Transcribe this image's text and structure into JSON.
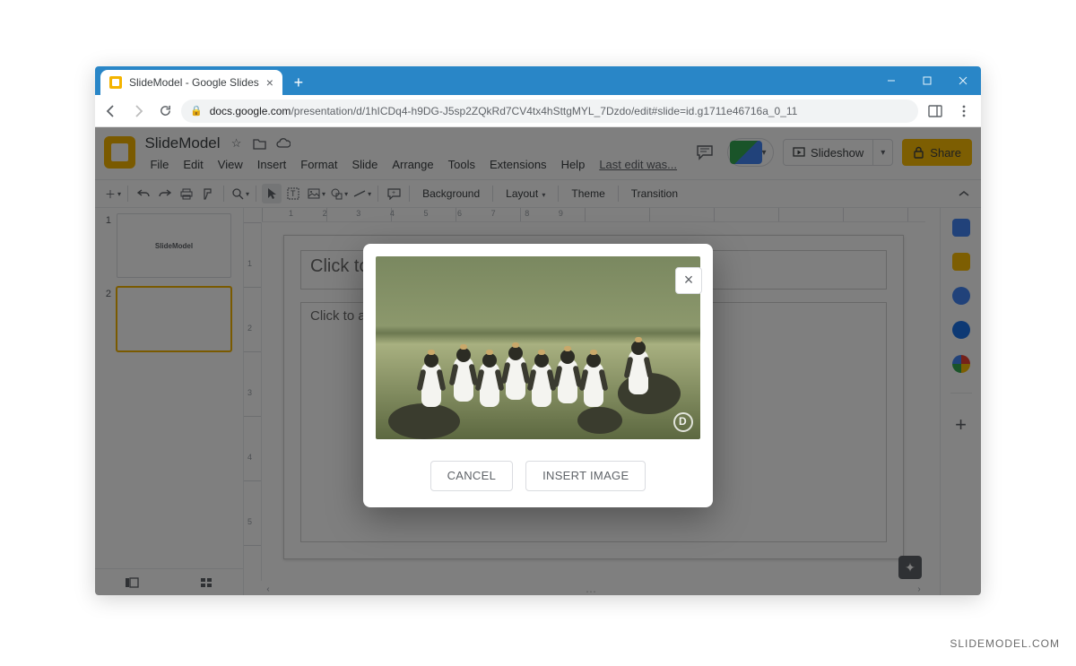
{
  "browser": {
    "tab_title": "SlideModel - Google Slides",
    "url_host": "docs.google.com",
    "url_path": "/presentation/d/1hICDq4-h9DG-J5sp2ZQkRd7CV4tx4hSttgMYL_7Dzdo/edit#slide=id.g1711e46716a_0_11"
  },
  "header": {
    "doc_title": "SlideModel",
    "last_edit": "Last edit was...",
    "slideshow": "Slideshow",
    "share": "Share"
  },
  "menu": {
    "file": "File",
    "edit": "Edit",
    "view": "View",
    "insert": "Insert",
    "format": "Format",
    "slide": "Slide",
    "arrange": "Arrange",
    "tools": "Tools",
    "extensions": "Extensions",
    "help": "Help"
  },
  "toolbar": {
    "background": "Background",
    "layout": "Layout",
    "theme": "Theme",
    "transition": "Transition"
  },
  "thumbs": [
    {
      "num": "1",
      "label": "SlideModel",
      "selected": false
    },
    {
      "num": "2",
      "label": "",
      "selected": true
    }
  ],
  "slide": {
    "title_placeholder": "Click to add title",
    "body_placeholder": "Click to add text"
  },
  "modal": {
    "cancel": "CANCEL",
    "insert": "INSERT IMAGE"
  },
  "watermark": "SLIDEMODEL.COM"
}
